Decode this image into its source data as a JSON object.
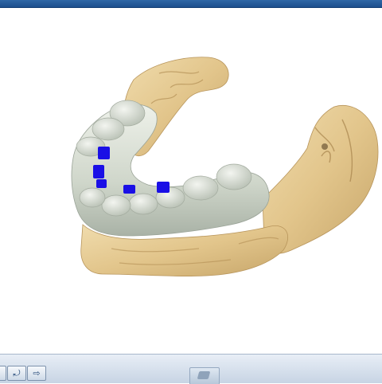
{
  "window": {
    "title_bar_color": "#1d4f8d"
  },
  "viewport": {
    "background": "#ffffff",
    "model": {
      "stone_color": "#e4cb96",
      "gingiva_color": "#d4dccf",
      "implant_color": "#1a0fe6",
      "implant_count": 5
    }
  },
  "taskbar": {
    "quick_launch": [
      {
        "icon": "show-desktop-icon",
        "glyph": ""
      },
      {
        "icon": "switch-windows-icon",
        "glyph": "⤾"
      },
      {
        "icon": "folder-arrow-icon",
        "glyph": "⇨"
      }
    ],
    "task_window_icon": "dental-cad-window-icon",
    "task_item_lines": [
      "",
      ""
    ]
  }
}
